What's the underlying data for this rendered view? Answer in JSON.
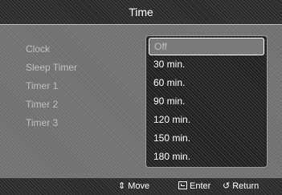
{
  "title": "Time",
  "menu": {
    "items": [
      {
        "label": "Clock"
      },
      {
        "label": "Sleep Timer"
      },
      {
        "label": "Timer 1"
      },
      {
        "label": "Timer 2"
      },
      {
        "label": "Timer 3"
      }
    ]
  },
  "dropdown": {
    "options": [
      {
        "label": "Off",
        "selected": true
      },
      {
        "label": "30 min."
      },
      {
        "label": "60 min."
      },
      {
        "label": "90 min."
      },
      {
        "label": "120 min."
      },
      {
        "label": "150 min."
      },
      {
        "label": "180 min."
      }
    ]
  },
  "footer": {
    "move_icon": "updown-arrow-icon",
    "move_label": "Move",
    "enter_icon": "enter-icon",
    "enter_label": "Enter",
    "return_icon": "return-arrow-icon",
    "return_label": "Return"
  }
}
